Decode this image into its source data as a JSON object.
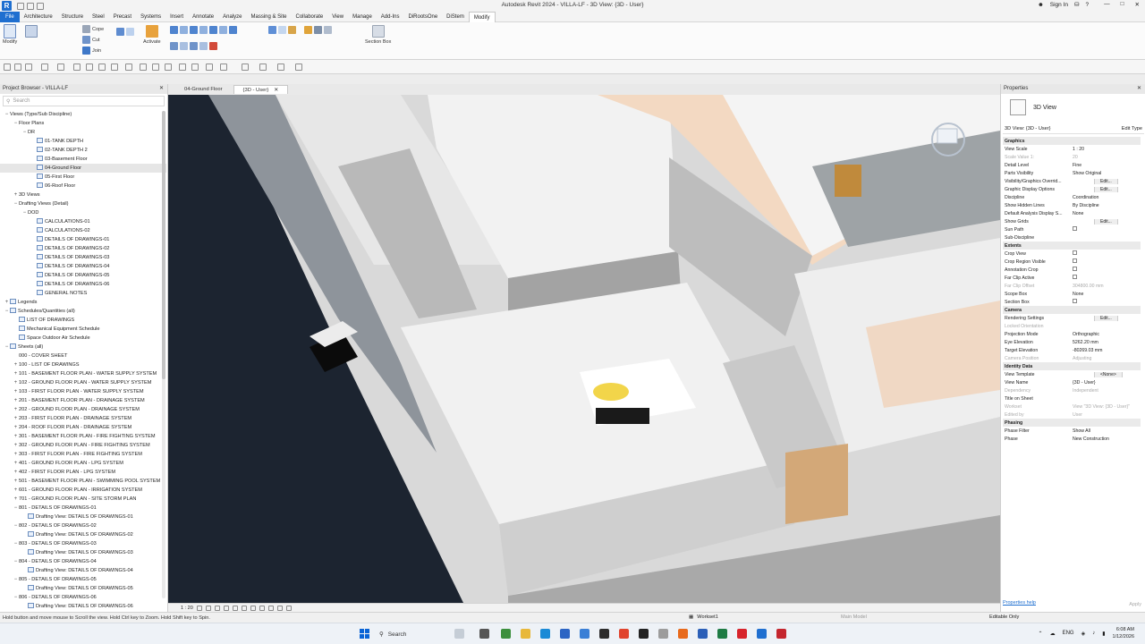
{
  "title": "Autodesk Revit 2024 - VILLA-LF - 3D View: {3D - User}",
  "titlebar": {
    "sign_in": "Sign In"
  },
  "ribbon_tabs": [
    "File",
    "Architecture",
    "Structure",
    "Steel",
    "Precast",
    "Systems",
    "Insert",
    "Annotate",
    "Analyze",
    "Massing & Site",
    "Collaborate",
    "View",
    "Manage",
    "Add-Ins",
    "DiRootsOne",
    "DiStem",
    "Modify"
  ],
  "ribbon": {
    "modify": "Modify",
    "cope": "Cope",
    "cut": "Cut",
    "join": "Join",
    "activate": "Activate",
    "section_box": "Section Box"
  },
  "project_browser": {
    "title": "Project Browser - VILLA-LF",
    "search_placeholder": "Search"
  },
  "tree": [
    {
      "label": "Views (Type/Sub Discipline)",
      "indent": 0,
      "toggle": "−",
      "icon": false
    },
    {
      "label": "Floor Plans",
      "indent": 1,
      "toggle": "−",
      "icon": false
    },
    {
      "label": "DR",
      "indent": 2,
      "toggle": "−",
      "icon": false
    },
    {
      "label": "01-TANK DEPTH",
      "indent": 3,
      "toggle": "",
      "icon": true
    },
    {
      "label": "02-TANK DEPTH 2",
      "indent": 3,
      "toggle": "",
      "icon": true
    },
    {
      "label": "03-Basement Floor",
      "indent": 3,
      "toggle": "",
      "icon": true
    },
    {
      "label": "04-Ground Floor",
      "indent": 3,
      "toggle": "",
      "icon": true,
      "selected": true
    },
    {
      "label": "05-First Floor",
      "indent": 3,
      "toggle": "",
      "icon": true
    },
    {
      "label": "06-Roof Floor",
      "indent": 3,
      "toggle": "",
      "icon": true
    },
    {
      "label": "3D Views",
      "indent": 1,
      "toggle": "+",
      "icon": false
    },
    {
      "label": "Drafting Views (Detail)",
      "indent": 1,
      "toggle": "−",
      "icon": false
    },
    {
      "label": "DOD",
      "indent": 2,
      "toggle": "−",
      "icon": false
    },
    {
      "label": "CALCULATIONS-01",
      "indent": 3,
      "toggle": "",
      "icon": true
    },
    {
      "label": "CALCULATIONS-02",
      "indent": 3,
      "toggle": "",
      "icon": true
    },
    {
      "label": "DETAILS OF DRAWINGS-01",
      "indent": 3,
      "toggle": "",
      "icon": true
    },
    {
      "label": "DETAILS OF DRAWINGS-02",
      "indent": 3,
      "toggle": "",
      "icon": true
    },
    {
      "label": "DETAILS OF DRAWINGS-03",
      "indent": 3,
      "toggle": "",
      "icon": true
    },
    {
      "label": "DETAILS OF DRAWINGS-04",
      "indent": 3,
      "toggle": "",
      "icon": true
    },
    {
      "label": "DETAILS OF DRAWINGS-05",
      "indent": 3,
      "toggle": "",
      "icon": true
    },
    {
      "label": "DETAILS OF DRAWINGS-06",
      "indent": 3,
      "toggle": "",
      "icon": true
    },
    {
      "label": "GENERAL NOTES",
      "indent": 3,
      "toggle": "",
      "icon": true
    },
    {
      "label": "Legends",
      "indent": 0,
      "toggle": "+",
      "icon": true
    },
    {
      "label": "Schedules/Quantities (all)",
      "indent": 0,
      "toggle": "−",
      "icon": true
    },
    {
      "label": "LIST OF DRAWINGS",
      "indent": 1,
      "toggle": "",
      "icon": true
    },
    {
      "label": "Mechanical Equipment Schedule",
      "indent": 1,
      "toggle": "",
      "icon": true
    },
    {
      "label": "Space Outdoor Air Schedule",
      "indent": 1,
      "toggle": "",
      "icon": true
    },
    {
      "label": "Sheets (all)",
      "indent": 0,
      "toggle": "−",
      "icon": true
    },
    {
      "label": "000 - COVER SHEET",
      "indent": 1,
      "toggle": "",
      "icon": false
    },
    {
      "label": "100 - LIST OF DRAWINGS",
      "indent": 1,
      "toggle": "+",
      "icon": false
    },
    {
      "label": "101 - BASEMENT FLOOR PLAN - WATER SUPPLY SYSTEM",
      "indent": 1,
      "toggle": "+",
      "icon": false
    },
    {
      "label": "102 - GROUND FLOOR PLAN - WATER SUPPLY SYSTEM",
      "indent": 1,
      "toggle": "+",
      "icon": false
    },
    {
      "label": "103 - FIRST FLOOR PLAN - WATER SUPPLY SYSTEM",
      "indent": 1,
      "toggle": "+",
      "icon": false
    },
    {
      "label": "201 - BASEMENT FLOOR PLAN - DRAINAGE SYSTEM",
      "indent": 1,
      "toggle": "+",
      "icon": false
    },
    {
      "label": "202 - GROUND FLOOR PLAN - DRAINAGE SYSTEM",
      "indent": 1,
      "toggle": "+",
      "icon": false
    },
    {
      "label": "203 - FIRST FLOOR PLAN - DRAINAGE SYSTEM",
      "indent": 1,
      "toggle": "+",
      "icon": false
    },
    {
      "label": "204 - ROOF FLOOR PLAN - DRAINAGE SYSTEM",
      "indent": 1,
      "toggle": "+",
      "icon": false
    },
    {
      "label": "301 - BASEMENT FLOOR PLAN - FIRE FIGHTING SYSTEM",
      "indent": 1,
      "toggle": "+",
      "icon": false
    },
    {
      "label": "302 - GROUND FLOOR PLAN - FIRE FIGHTING SYSTEM",
      "indent": 1,
      "toggle": "+",
      "icon": false
    },
    {
      "label": "303 - FIRST FLOOR PLAN - FIRE FIGHTING SYSTEM",
      "indent": 1,
      "toggle": "+",
      "icon": false
    },
    {
      "label": "401 - GROUND FLOOR PLAN - LPG SYSTEM",
      "indent": 1,
      "toggle": "+",
      "icon": false
    },
    {
      "label": "402 - FIRST FLOOR PLAN - LPG SYSTEM",
      "indent": 1,
      "toggle": "+",
      "icon": false
    },
    {
      "label": "501 - BASEMENT FLOOR PLAN - SWIMMING POOL SYSTEM",
      "indent": 1,
      "toggle": "+",
      "icon": false
    },
    {
      "label": "601 - GROUND FLOOR PLAN - IRRIGATION SYSTEM",
      "indent": 1,
      "toggle": "+",
      "icon": false
    },
    {
      "label": "701 - GROUND FLOOR PLAN - SITE STORM PLAN",
      "indent": 1,
      "toggle": "+",
      "icon": false
    },
    {
      "label": "801 - DETAILS OF DRAWINGS-01",
      "indent": 1,
      "toggle": "−",
      "icon": false
    },
    {
      "label": "Drafting View: DETAILS OF DRAWINGS-01",
      "indent": 2,
      "toggle": "",
      "icon": true
    },
    {
      "label": "802 - DETAILS OF DRAWINGS-02",
      "indent": 1,
      "toggle": "−",
      "icon": false
    },
    {
      "label": "Drafting View: DETAILS OF DRAWINGS-02",
      "indent": 2,
      "toggle": "",
      "icon": true
    },
    {
      "label": "803 - DETAILS OF DRAWINGS-03",
      "indent": 1,
      "toggle": "−",
      "icon": false
    },
    {
      "label": "Drafting View: DETAILS OF DRAWINGS-03",
      "indent": 2,
      "toggle": "",
      "icon": true
    },
    {
      "label": "804 - DETAILS OF DRAWINGS-04",
      "indent": 1,
      "toggle": "−",
      "icon": false
    },
    {
      "label": "Drafting View: DETAILS OF DRAWINGS-04",
      "indent": 2,
      "toggle": "",
      "icon": true
    },
    {
      "label": "805 - DETAILS OF DRAWINGS-05",
      "indent": 1,
      "toggle": "−",
      "icon": false
    },
    {
      "label": "Drafting View: DETAILS OF DRAWINGS-05",
      "indent": 2,
      "toggle": "",
      "icon": true
    },
    {
      "label": "806 - DETAILS OF DRAWINGS-06",
      "indent": 1,
      "toggle": "−",
      "icon": false
    },
    {
      "label": "Drafting View: DETAILS OF DRAWINGS-06",
      "indent": 2,
      "toggle": "",
      "icon": true
    }
  ],
  "view_tabs": {
    "tab1": "04-Ground Floor",
    "tab2": "{3D - User}"
  },
  "view_controls": {
    "scale": "1 : 20"
  },
  "properties": {
    "title": "Properties",
    "type_name": "3D View",
    "type_selector": "3D View: {3D - User}",
    "edit_type": "Edit Type",
    "help_link": "Properties help",
    "apply": "Apply",
    "rows": [
      {
        "k": "Graphics",
        "v": "",
        "section": true
      },
      {
        "k": "View Scale",
        "v": "1 : 20"
      },
      {
        "k": "Scale Value    1:",
        "v": "20",
        "dim": true
      },
      {
        "k": "Detail Level",
        "v": "Fine"
      },
      {
        "k": "Parts Visibility",
        "v": "Show Original"
      },
      {
        "k": "Visibility/Graphics Overrid...",
        "v": "Edit...",
        "button": true
      },
      {
        "k": "Graphic Display Options",
        "v": "Edit...",
        "button": true
      },
      {
        "k": "Discipline",
        "v": "Coordination"
      },
      {
        "k": "Show Hidden Lines",
        "v": "By Discipline"
      },
      {
        "k": "Default Analysis Display S...",
        "v": "None"
      },
      {
        "k": "Show Grids",
        "v": "Edit...",
        "button": true
      },
      {
        "k": "Sun Path",
        "v": "",
        "check": true
      },
      {
        "k": "Sub-Discipline",
        "v": ""
      },
      {
        "k": "Extents",
        "v": "",
        "section": true
      },
      {
        "k": "Crop View",
        "v": "",
        "check": true
      },
      {
        "k": "Crop Region Visible",
        "v": "",
        "check": true
      },
      {
        "k": "Annotation Crop",
        "v": "",
        "check": true
      },
      {
        "k": "Far Clip Active",
        "v": "",
        "check": true
      },
      {
        "k": "Far Clip Offset",
        "v": "304800.00 mm",
        "dim": true
      },
      {
        "k": "Scope Box",
        "v": "None"
      },
      {
        "k": "Section Box",
        "v": "",
        "check": true
      },
      {
        "k": "Camera",
        "v": "",
        "section": true
      },
      {
        "k": "Rendering Settings",
        "v": "Edit...",
        "button": true
      },
      {
        "k": "Locked Orientation",
        "v": "",
        "dim": true
      },
      {
        "k": "Projection Mode",
        "v": "Orthographic"
      },
      {
        "k": "Eye Elevation",
        "v": "5262.20 mm"
      },
      {
        "k": "Target Elevation",
        "v": "-80269.03 mm"
      },
      {
        "k": "Camera Position",
        "v": "Adjusting",
        "dim": true
      },
      {
        "k": "Identity Data",
        "v": "",
        "section": true
      },
      {
        "k": "View Template",
        "v": "<None>",
        "button": true
      },
      {
        "k": "View Name",
        "v": "{3D - User}"
      },
      {
        "k": "Dependency",
        "v": "Independent",
        "dim": true
      },
      {
        "k": "Title on Sheet",
        "v": ""
      },
      {
        "k": "Workset",
        "v": "View \"3D View: {3D - User}\"",
        "dim": true
      },
      {
        "k": "Edited by",
        "v": "User",
        "dim": true
      },
      {
        "k": "Phasing",
        "v": "",
        "section": true
      },
      {
        "k": "Phase Filter",
        "v": "Show All"
      },
      {
        "k": "Phase",
        "v": "New Construction"
      }
    ]
  },
  "status": {
    "message": "Hold button and move mouse to Scroll the view. Hold Ctrl key to Zoom. Hold Shift key to Spin.",
    "workset": "Workset1",
    "model": "Main Model",
    "editable": "Editable Only"
  },
  "taskbar": {
    "search": "Search",
    "lang": "ENG",
    "time": "6:08 AM",
    "date": "1/12/2026"
  },
  "colors": {
    "accent": "#1f6fd0",
    "viewport_bg": "#c7c7c7",
    "slab": "#efefef",
    "warm": "#f3d9c2"
  }
}
